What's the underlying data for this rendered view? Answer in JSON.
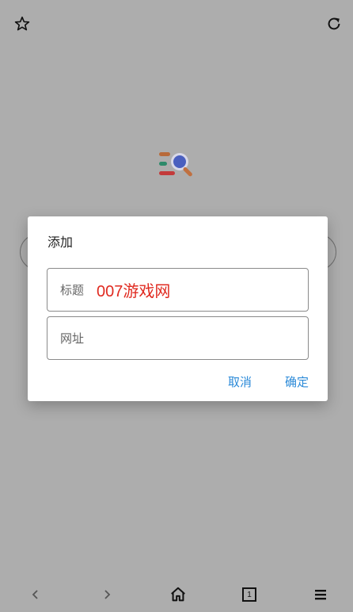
{
  "topbar": {
    "bookmark_icon": "star-outline-icon",
    "refresh_icon": "refresh-icon"
  },
  "dialog": {
    "title": "添加",
    "title_field": {
      "label": "标题",
      "value": "007游戏网"
    },
    "url_field": {
      "label": "网址",
      "value": ""
    },
    "cancel_label": "取消",
    "confirm_label": "确定",
    "accent_color": "#2b8ad8",
    "value_color": "#e02a20"
  },
  "bottom_nav": {
    "items": [
      "back-icon",
      "forward-icon",
      "home-icon",
      "tabs-icon",
      "menu-icon"
    ],
    "tab_count": "1"
  }
}
